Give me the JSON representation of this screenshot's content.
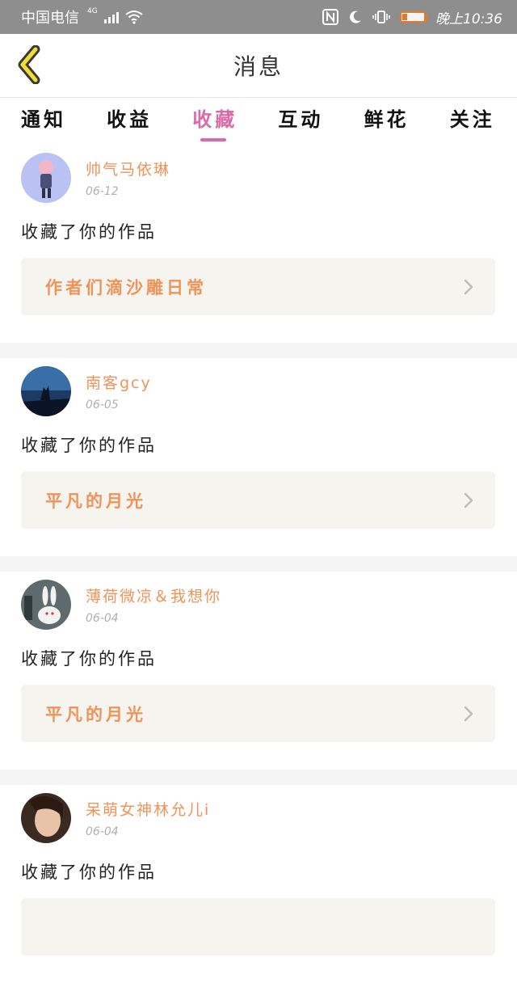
{
  "status_bar": {
    "carrier": "中国电信",
    "network": "4G",
    "time": "晚上10:36"
  },
  "header": {
    "title": "消息"
  },
  "tabs": [
    {
      "label": "通知",
      "active": false
    },
    {
      "label": "收益",
      "active": false
    },
    {
      "label": "收藏",
      "active": true
    },
    {
      "label": "互动",
      "active": false
    },
    {
      "label": "鲜花",
      "active": false
    },
    {
      "label": "关注",
      "active": false
    }
  ],
  "colors": {
    "accent_pink": "#d86ba8",
    "accent_orange": "#f0935a",
    "card_bg": "#f5f4ee"
  },
  "feed": [
    {
      "user": "帅气马依琳",
      "date": "06-12",
      "action": "收藏了你的作品",
      "work": "作者们滴沙雕日常",
      "avatar": "anime-girl-avatar"
    },
    {
      "user": "南客gcy",
      "date": "06-05",
      "action": "收藏了你的作品",
      "work": "平凡的月光",
      "avatar": "wolf-night-avatar"
    },
    {
      "user": "薄荷微凉＆我想你",
      "date": "06-04",
      "action": "收藏了你的作品",
      "work": "平凡的月光",
      "avatar": "rabbit-avatar"
    },
    {
      "user": "呆萌女神林允儿i",
      "date": "06-04",
      "action": "收藏了你的作品",
      "work": "",
      "avatar": "portrait-avatar"
    }
  ]
}
